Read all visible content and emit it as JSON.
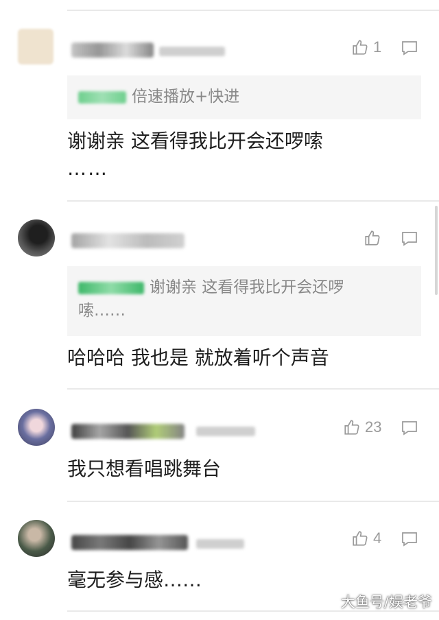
{
  "comments": [
    {
      "like_count": "1",
      "quote_text": "倍速播放+快进",
      "text": "谢谢亲 这看得我比开会还啰嗦",
      "text_continued": "……",
      "avatar_color": "#efe3cf"
    },
    {
      "like_count": "",
      "quote_text": "谢谢亲 这看得我比开会还啰",
      "quote_text_continued": "嗦……",
      "text": "哈哈哈 我也是 就放着听个声音",
      "avatar_color": "#3a3a3a"
    },
    {
      "like_count": "23",
      "text": "我只想看唱跳舞台",
      "avatar_color": "#6a6fa0"
    },
    {
      "like_count": "4",
      "text": "毫无参与感……",
      "avatar_color": "#4a5a48"
    }
  ],
  "watermark": "大鱼号/娱老爷",
  "colors": {
    "icon_gray": "#9a9a9a",
    "quote_bg": "#f5f5f5",
    "divider": "#e9e9e9"
  },
  "icons": {
    "like": "thumbs-up-icon",
    "reply": "comment-bubble-icon"
  }
}
